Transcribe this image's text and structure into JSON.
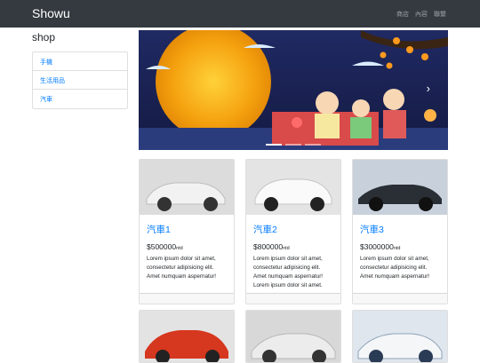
{
  "navbar": {
    "brand": "Showu",
    "links": [
      "商店",
      "內容",
      "聯繫"
    ]
  },
  "sidebar": {
    "title": "shop",
    "items": [
      "手機",
      "生活用品",
      "汽車"
    ]
  },
  "carousel": {
    "next_icon": "chevron-right-icon",
    "indicator_count": 3,
    "active_index": 0
  },
  "products": [
    {
      "title": "汽車1",
      "price": "$500000",
      "unit": "ntd",
      "text": "Lorem ipsum dolor sit amet, consectetur adipisicing elit. Amet numquam aspernatur!",
      "color": "#e6e6e6"
    },
    {
      "title": "汽車2",
      "price": "$800000",
      "unit": "ntd",
      "text": "Lorem ipsum dolor sit amet, consectetur adipisicing elit. Amet numquam aspernatur! Lorem ipsum dolor sit amet.",
      "color": "#f0f0f0"
    },
    {
      "title": "汽車3",
      "price": "$3000000",
      "unit": "ntd",
      "text": "Lorem ipsum dolor sit amet, consectetur adipisicing elit. Amet numquam aspernatur!",
      "color": "#2b2f36"
    }
  ],
  "colors": {
    "navbar_bg": "#343a40",
    "link": "#007bff"
  }
}
